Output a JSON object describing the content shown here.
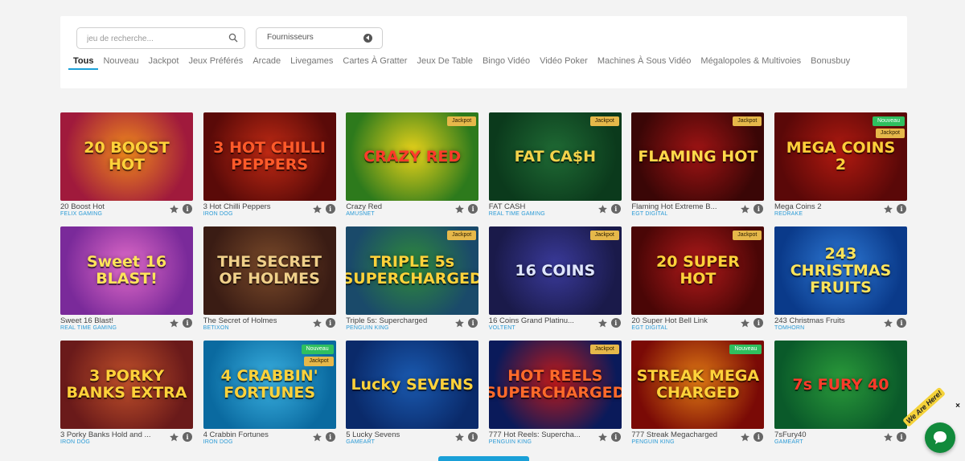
{
  "filters": {
    "search_placeholder": "jeu de recherche...",
    "provider_label": "Fournisseurs"
  },
  "tabs": [
    {
      "label": "Tous",
      "active": true
    },
    {
      "label": "Nouveau"
    },
    {
      "label": "Jackpot"
    },
    {
      "label": "Jeux Préférés"
    },
    {
      "label": "Arcade"
    },
    {
      "label": "Livegames"
    },
    {
      "label": "Cartes À Gratter"
    },
    {
      "label": "Jeux De Table"
    },
    {
      "label": "Bingo Vidéo"
    },
    {
      "label": "Vidéo Poker"
    },
    {
      "label": "Machines À Sous Vidéo"
    },
    {
      "label": "Mégalopoles & Multivoies"
    },
    {
      "label": "Bonusbuy"
    }
  ],
  "badge_labels": {
    "jackpot": "Jackpot",
    "new": "Nouveau"
  },
  "games": [
    {
      "name": "20 Boost Hot",
      "provider": "FELIX GAMING",
      "art": "20 BOOST HOT",
      "badges": [],
      "bg": "#a01a3c",
      "bg2": "#f08a1c",
      "fg": "#ffd23a"
    },
    {
      "name": "3 Hot Chilli Peppers",
      "provider": "IRON DOG",
      "art": "3 HOT CHILLI PEPPERS",
      "badges": [],
      "bg": "#5a0a08",
      "bg2": "#c02a14",
      "fg": "#ff5a2a"
    },
    {
      "name": "Crazy Red",
      "provider": "AMUSNET",
      "art": "CRAZY RED",
      "badges": [
        "jackpot"
      ],
      "bg": "#2d7a1c",
      "bg2": "#e9d21a",
      "fg": "#ff3a2a"
    },
    {
      "name": "FAT CASH",
      "provider": "REAL TIME GAMING",
      "art": "FAT CA$H",
      "badges": [
        "jackpot"
      ],
      "bg": "#0b3a1c",
      "bg2": "#1f6a34",
      "fg": "#f3d24a"
    },
    {
      "name": "Flaming Hot Extreme B...",
      "provider": "EGT DIGITAL",
      "art": "FLAMING HOT",
      "badges": [
        "jackpot"
      ],
      "bg": "#3a0606",
      "bg2": "#a01414",
      "fg": "#ffd84a"
    },
    {
      "name": "Mega Coins 2",
      "provider": "REDRAKE",
      "art": "MEGA COINS 2",
      "badges": [
        "new",
        "jackpot"
      ],
      "bg": "#5a0808",
      "bg2": "#b01a10",
      "fg": "#ffcf3a"
    },
    {
      "name": "Sweet 16 Blast!",
      "provider": "REAL TIME GAMING",
      "art": "Sweet 16 BLAST!",
      "badges": [],
      "bg": "#7a2a9a",
      "bg2": "#e06ac8",
      "fg": "#ffe45a"
    },
    {
      "name": "The Secret of Holmes",
      "provider": "BETIXON",
      "art": "THE SECRET OF HOLMES",
      "badges": [],
      "bg": "#3a1c14",
      "bg2": "#7a4a2a",
      "fg": "#f0d08a"
    },
    {
      "name": "Triple 5s: Supercharged",
      "provider": "PENGUIN KING",
      "art": "TRIPLE 5s SUPERCHARGED",
      "badges": [
        "jackpot"
      ],
      "bg": "#1a4a6a",
      "bg2": "#2f8a3a",
      "fg": "#ffd23a"
    },
    {
      "name": "16 Coins Grand Platinu...",
      "provider": "VOLTENT",
      "art": "16 COINS",
      "badges": [
        "jackpot"
      ],
      "bg": "#1a1a4a",
      "bg2": "#3a3a9a",
      "fg": "#dfe6ff"
    },
    {
      "name": "20 Super Hot Bell Link",
      "provider": "EGT DIGITAL",
      "art": "20 SUPER HOT",
      "badges": [
        "jackpot"
      ],
      "bg": "#4a0606",
      "bg2": "#b01a1a",
      "fg": "#ffd23a"
    },
    {
      "name": "243 Christmas Fruits",
      "provider": "TOMHORN",
      "art": "243 CHRISTMAS FRUITS",
      "badges": [],
      "bg": "#0a3a8a",
      "bg2": "#2f7ad6",
      "fg": "#ffe45a"
    },
    {
      "name": "3 Porky Banks Hold and ...",
      "provider": "IRON DOG",
      "art": "3 PORKY BANKS EXTRA",
      "badges": [],
      "bg": "#6a1a1a",
      "bg2": "#c0502a",
      "fg": "#ffd23a"
    },
    {
      "name": "4 Crabbin Fortunes",
      "provider": "IRON DOG",
      "art": "4 CRABBIN' FORTUNES",
      "badges": [
        "new",
        "jackpot"
      ],
      "bg": "#0a6aa0",
      "bg2": "#3ab0e0",
      "fg": "#ffd23a"
    },
    {
      "name": "5 Lucky Sevens",
      "provider": "GAMEART",
      "art": "Lucky SEVENS",
      "badges": [],
      "bg": "#0a2a6a",
      "bg2": "#1a5ab0",
      "fg": "#ffd23a"
    },
    {
      "name": "777 Hot Reels: Supercha...",
      "provider": "PENGUIN KING",
      "art": "HOT REELS SUPERCHARGED",
      "badges": [
        "jackpot"
      ],
      "bg": "#0a1a5a",
      "bg2": "#c01a1a",
      "fg": "#ff6a2a"
    },
    {
      "name": "777 Streak Megacharged",
      "provider": "PENGUIN KING",
      "art": "STREAK MEGA CHARGED",
      "badges": [
        "new"
      ],
      "bg": "#7a0a06",
      "bg2": "#e07a14",
      "fg": "#ffd23a"
    },
    {
      "name": "7sFury40",
      "provider": "GAMEART",
      "art": "7s FURY 40",
      "badges": [],
      "bg": "#0a5a2a",
      "bg2": "#2a9a3a",
      "fg": "#ff3a2a"
    }
  ],
  "chat": {
    "tag": "We Are Here!",
    "close": "×"
  },
  "colors": {
    "accent": "#1aa0d8",
    "provider_text": "#2b9bd6"
  }
}
